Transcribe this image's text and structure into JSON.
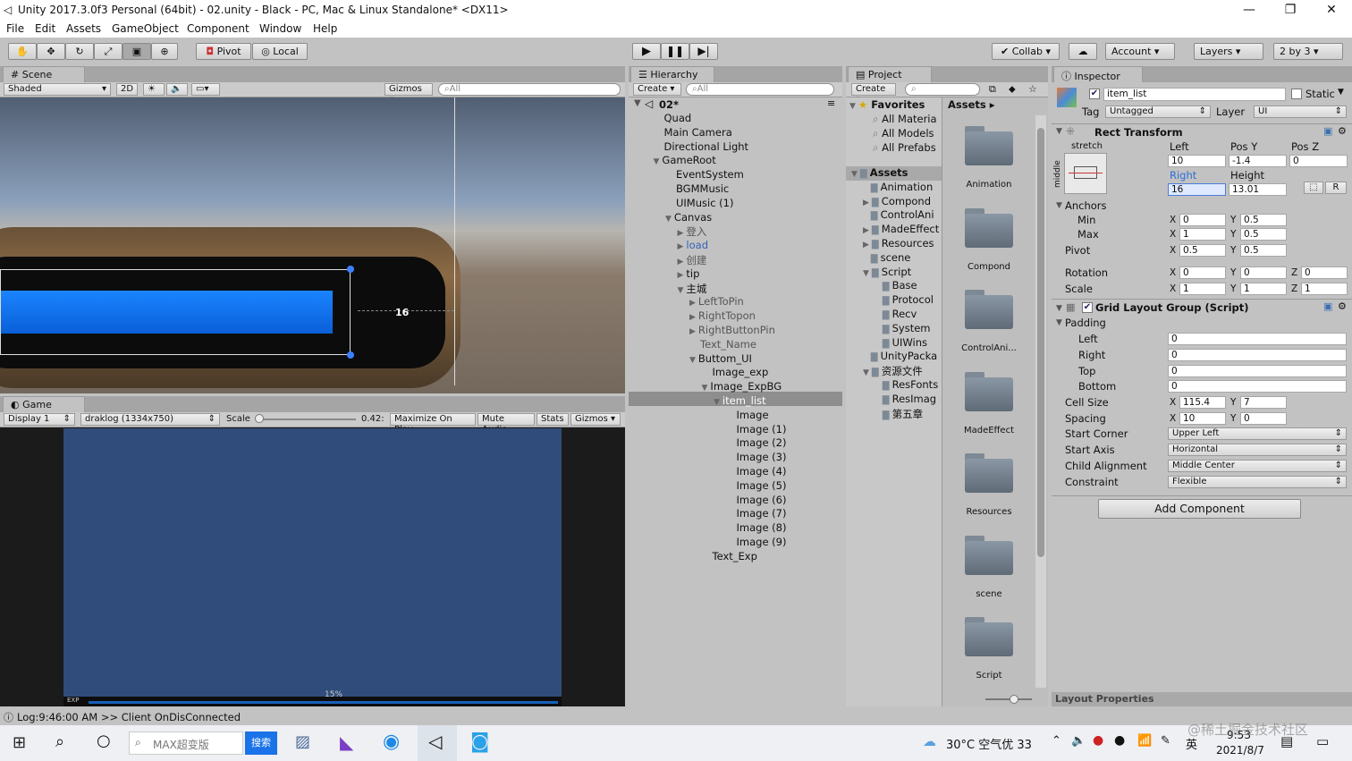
{
  "window": {
    "title": "Unity 2017.3.0f3 Personal (64bit) - 02.unity - Black - PC, Mac & Linux Standalone* <DX11>"
  },
  "menu": [
    "File",
    "Edit",
    "Assets",
    "GameObject",
    "Component",
    "Window",
    "Help"
  ],
  "toolbar": {
    "pivot": "Pivot",
    "local": "Local",
    "collab": "Collab",
    "account": "Account",
    "layers": "Layers",
    "layout": "2 by 3"
  },
  "scene": {
    "tab": "Scene",
    "shading": "Shaded",
    "mode2d": "2D",
    "gizmos": "Gizmos",
    "search_placeholder": "All",
    "measure": "16"
  },
  "game": {
    "tab": "Game",
    "display": "Display 1",
    "resolution": "draklog (1334x750)",
    "scale_label": "Scale",
    "scale_value": "0.42:",
    "maximize": "Maximize On Play",
    "mute": "Mute Audio",
    "stats": "Stats",
    "gizmos": "Gizmos",
    "exp_label": "EXP",
    "percent": "15%"
  },
  "hierarchy": {
    "tab": "Hierarchy",
    "create": "Create",
    "search_placeholder": "All",
    "scene": "02*",
    "items": [
      {
        "label": "Quad",
        "depth": 1
      },
      {
        "label": "Main Camera",
        "depth": 1
      },
      {
        "label": "Directional Light",
        "depth": 1
      },
      {
        "label": "GameRoot",
        "depth": 1,
        "arrow": "▼"
      },
      {
        "label": "EventSystem",
        "depth": 2
      },
      {
        "label": "BGMMusic",
        "depth": 2
      },
      {
        "label": "UIMusic (1)",
        "depth": 2
      },
      {
        "label": "Canvas",
        "depth": 2,
        "arrow": "▼"
      },
      {
        "label": "登入",
        "depth": 3,
        "arrow": "▶",
        "dim": true
      },
      {
        "label": "load",
        "depth": 3,
        "arrow": "▶",
        "blue": true
      },
      {
        "label": "创建",
        "depth": 3,
        "arrow": "▶",
        "dim": true
      },
      {
        "label": "tip",
        "depth": 3,
        "arrow": "▶"
      },
      {
        "label": "主城",
        "depth": 3,
        "arrow": "▼"
      },
      {
        "label": "LeftToPin",
        "depth": 4,
        "arrow": "▶",
        "dim": true
      },
      {
        "label": "RightTopon",
        "depth": 4,
        "arrow": "▶",
        "dim": true
      },
      {
        "label": "RightButtonPin",
        "depth": 4,
        "arrow": "▶",
        "dim": true
      },
      {
        "label": "Text_Name",
        "depth": 4,
        "dim": true
      },
      {
        "label": "Buttom_UI",
        "depth": 4,
        "arrow": "▼"
      },
      {
        "label": "Image_exp",
        "depth": 5
      },
      {
        "label": "Image_ExpBG",
        "depth": 5,
        "arrow": "▼"
      },
      {
        "label": "item_list",
        "depth": 6,
        "arrow": "▼",
        "selected": true
      },
      {
        "label": "Image",
        "depth": 7
      },
      {
        "label": "Image (1)",
        "depth": 7
      },
      {
        "label": "Image (2)",
        "depth": 7
      },
      {
        "label": "Image (3)",
        "depth": 7
      },
      {
        "label": "Image (4)",
        "depth": 7
      },
      {
        "label": "Image (5)",
        "depth": 7
      },
      {
        "label": "Image (6)",
        "depth": 7
      },
      {
        "label": "Image (7)",
        "depth": 7
      },
      {
        "label": "Image (8)",
        "depth": 7
      },
      {
        "label": "Image (9)",
        "depth": 7
      },
      {
        "label": "Text_Exp",
        "depth": 5
      }
    ]
  },
  "project": {
    "tab": "Project",
    "create": "Create",
    "favorites": "Favorites",
    "assets_header": "Assets",
    "fav_items": [
      "All Materia",
      "All Models",
      "All Prefabs"
    ],
    "tree": [
      {
        "label": "Assets",
        "depth": 0,
        "arrow": "▼",
        "bold": true
      },
      {
        "label": "Animation",
        "depth": 1
      },
      {
        "label": "Compond",
        "depth": 1,
        "arrow": "▶"
      },
      {
        "label": "ControlAni",
        "depth": 1
      },
      {
        "label": "MadeEffect",
        "depth": 1,
        "arrow": "▶"
      },
      {
        "label": "Resources",
        "depth": 1,
        "arrow": "▶"
      },
      {
        "label": "scene",
        "depth": 1
      },
      {
        "label": "Script",
        "depth": 1,
        "arrow": "▼"
      },
      {
        "label": "Base",
        "depth": 2
      },
      {
        "label": "Protocol",
        "depth": 2
      },
      {
        "label": "Recv",
        "depth": 2
      },
      {
        "label": "System",
        "depth": 2
      },
      {
        "label": "UIWins",
        "depth": 2
      },
      {
        "label": "UnityPacka",
        "depth": 1
      },
      {
        "label": "资源文件",
        "depth": 1,
        "arrow": "▼"
      },
      {
        "label": "ResFonts",
        "depth": 2
      },
      {
        "label": "ResImag",
        "depth": 2
      },
      {
        "label": "第五章",
        "depth": 2
      }
    ],
    "folders": [
      "Animation",
      "Compond",
      "ControlAni...",
      "MadeEffect",
      "Resources",
      "scene",
      "Script"
    ]
  },
  "inspector": {
    "tab": "Inspector",
    "name": "item_list",
    "static": "Static",
    "tag_label": "Tag",
    "tag": "Untagged",
    "layer_label": "Layer",
    "layer": "UI",
    "rect": {
      "title": "Rect Transform",
      "stretch": "stretch",
      "middle": "middle",
      "left_label": "Left",
      "posy_label": "Pos Y",
      "posz_label": "Pos Z",
      "left": "10",
      "posy": "-1.4",
      "posz": "0",
      "right_label": "Right",
      "height_label": "Height",
      "right": "16",
      "height": "13.01",
      "r_btn": "R",
      "anchors": "Anchors",
      "min": "Min",
      "max": "Max",
      "pivot": "Pivot",
      "min_x": "0",
      "min_y": "0.5",
      "max_x": "1",
      "max_y": "0.5",
      "pivot_x": "0.5",
      "pivot_y": "0.5",
      "rotation": "Rotation",
      "scale": "Scale",
      "rot_x": "0",
      "rot_y": "0",
      "rot_z": "0",
      "scale_x": "1",
      "scale_y": "1",
      "scale_z": "1"
    },
    "grid": {
      "title": "Grid Layout Group (Script)",
      "padding": "Padding",
      "left": "Left",
      "right": "Right",
      "top": "Top",
      "bottom": "Bottom",
      "pad_left": "0",
      "pad_right": "0",
      "pad_top": "0",
      "pad_bottom": "0",
      "cell_size": "Cell Size",
      "cell_x": "115.4",
      "cell_y": "7",
      "spacing": "Spacing",
      "spacing_x": "10",
      "spacing_y": "0",
      "start_corner": "Start Corner",
      "start_corner_val": "Upper Left",
      "start_axis": "Start Axis",
      "start_axis_val": "Horizontal",
      "child_alignment": "Child Alignment",
      "child_alignment_val": "Middle Center",
      "constraint": "Constraint",
      "constraint_val": "Flexible"
    },
    "add_component": "Add Component",
    "layout_properties": "Layout Properties"
  },
  "status": "Log:9:46:00 AM >> Client OnDisConnected",
  "taskbar": {
    "search_placeholder": "MAX超变版",
    "search_btn": "搜索",
    "weather": "30°C 空气优 33",
    "ime": "英",
    "time": "9:53",
    "date": "2021/8/7",
    "watermark": "@稀土掘金技术社区"
  }
}
